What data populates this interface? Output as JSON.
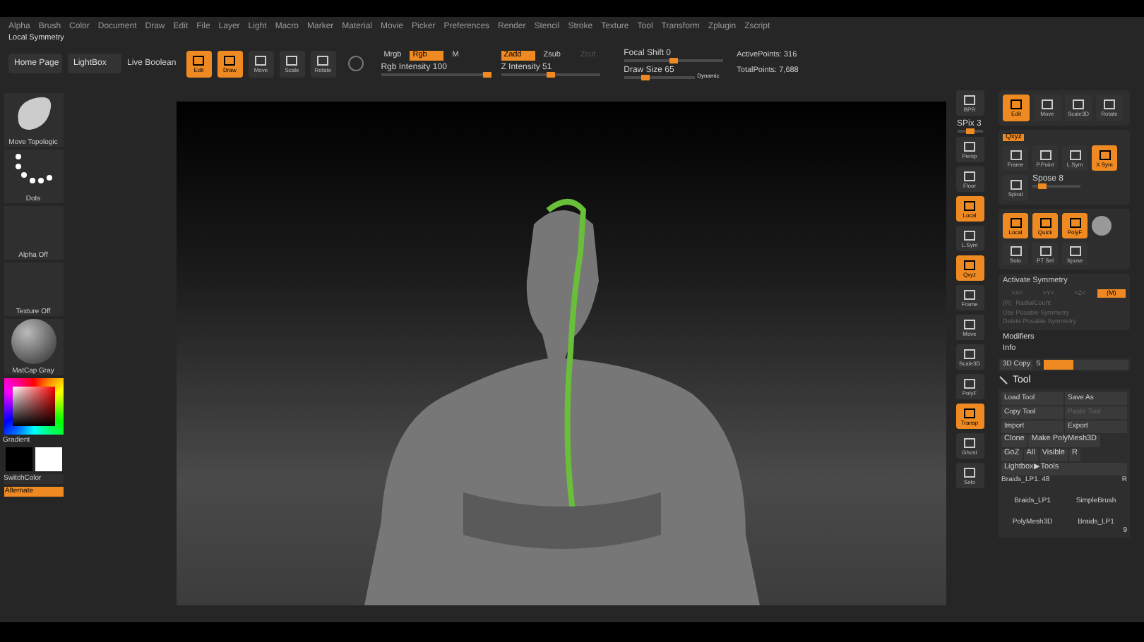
{
  "menu": [
    "Alpha",
    "Brush",
    "Color",
    "Document",
    "Draw",
    "Edit",
    "File",
    "Layer",
    "Light",
    "Macro",
    "Marker",
    "Material",
    "Movie",
    "Picker",
    "Preferences",
    "Render",
    "Stencil",
    "Stroke",
    "Texture",
    "Tool",
    "Transform",
    "Zplugin",
    "Zscript"
  ],
  "local_symmetry": "Local Symmetry",
  "toolbar": {
    "buttons": [
      "Home Page",
      "LightBox"
    ],
    "live_boolean": "Live Boolean",
    "modes": [
      {
        "label": "Edit",
        "selected": true
      },
      {
        "label": "Draw",
        "selected": true
      },
      {
        "label": "Move",
        "selected": false
      },
      {
        "label": "Scale",
        "selected": false
      },
      {
        "label": "Rotate",
        "selected": false
      }
    ],
    "color_modes": [
      {
        "label": "Mrgb",
        "selected": false
      },
      {
        "label": "Rgb",
        "selected": true
      },
      {
        "label": "M",
        "selected": false
      }
    ],
    "z_modes": [
      {
        "label": "Zadd",
        "selected": true,
        "disabled": false
      },
      {
        "label": "Zsub",
        "selected": false,
        "disabled": false
      },
      {
        "label": "Zcut",
        "selected": false,
        "disabled": true
      }
    ],
    "sliders": [
      {
        "label": "Rgb Intensity 100",
        "level": 1.0
      },
      {
        "label": "Z Intensity 51",
        "level": 0.51
      },
      {
        "label": "Focal Shift 0",
        "level": 0.5
      },
      {
        "label": "Draw Size 65",
        "level": 0.3
      }
    ],
    "dynamic": "Dynamic",
    "active_points": "ActivePoints: 316",
    "total_points": "TotalPoints: 7,688"
  },
  "left_panel": {
    "brush": "Move Topologic",
    "stroke": "Dots",
    "alpha": "Alpha Off",
    "texture": "Texture Off",
    "material": "MatCap Gray",
    "gradient": "Gradient",
    "switch_color": "SwitchColor",
    "alternate": {
      "label": "Alternate",
      "on": true
    }
  },
  "right_strip": [
    {
      "kind": "button",
      "label": "BPR",
      "on": false
    },
    {
      "kind": "slider",
      "label": "SPix 3",
      "level": 0.5
    },
    {
      "kind": "button",
      "label": "Persp",
      "on": false
    },
    {
      "kind": "button",
      "label": "Floor",
      "on": false
    },
    {
      "kind": "button",
      "label": "Local",
      "on": true
    },
    {
      "kind": "button",
      "label": "L.Sym",
      "on": false
    },
    {
      "kind": "button",
      "label": "Qxyz",
      "on": true
    },
    {
      "kind": "button",
      "label": "Frame",
      "on": false
    },
    {
      "kind": "button",
      "label": "Move",
      "on": false
    },
    {
      "kind": "button",
      "label": "Scale3D",
      "on": false
    },
    {
      "kind": "button",
      "label": "PolyF",
      "on": false
    },
    {
      "kind": "button",
      "label": "Transp",
      "on": true
    },
    {
      "kind": "button",
      "label": "Ghost",
      "on": false
    },
    {
      "kind": "button",
      "label": "Solo",
      "on": false
    }
  ],
  "right_panel": {
    "tools": [
      {
        "label": "Edit",
        "selected": true
      },
      {
        "label": "Move",
        "selected": false
      },
      {
        "label": "Scale3D",
        "selected": false
      },
      {
        "label": "Rotate",
        "selected": false
      }
    ],
    "transform": {
      "tab": "Qxyz",
      "buttons": [
        {
          "label": "Frame",
          "on": false
        },
        {
          "label": "P.Point",
          "on": false
        },
        {
          "label": "L.Sym",
          "on": false
        },
        {
          "label": "X Sym",
          "on": true
        },
        {
          "label": "Spiral",
          "on": false
        }
      ],
      "spose": {
        "label": "Spose 8",
        "level": 0.2
      },
      "row2": [
        {
          "label": "Local",
          "on": true
        },
        {
          "label": "Quick",
          "on": true
        },
        {
          "label": "PolyF",
          "on": true
        }
      ],
      "row3": [
        "Solo",
        "PT Sel",
        "Xpose"
      ]
    },
    "symmetry": {
      "title": "Activate Symmetry",
      "axes": [
        {
          "label": ">X<",
          "on": false
        },
        {
          "label": ">Y<",
          "on": false
        },
        {
          "label": ">Z<",
          "on": false
        },
        {
          "label": "(M)",
          "on": true
        }
      ],
      "r": "(R)",
      "radial": "RadialCount",
      "use": "Use Posable Symmetry",
      "delete": "Delete Posable Symmetry"
    },
    "modifiers": "Modifiers",
    "info": "Info",
    "copy": {
      "label": "3D Copy",
      "s": "S",
      "level": 0.35
    },
    "tool": {
      "title": "Tool",
      "buttons": [
        {
          "label": "Load Tool",
          "disabled": false
        },
        {
          "label": "Save As",
          "disabled": false
        },
        {
          "label": "Copy Tool",
          "disabled": false
        },
        {
          "label": "Paste Tool",
          "disabled": true
        },
        {
          "label": "Import",
          "disabled": false
        },
        {
          "label": "Export",
          "disabled": false
        }
      ],
      "clone": "Clone",
      "make": "Make PolyMesh3D",
      "goz": "GoZ",
      "all": "All",
      "visible": "Visible",
      "r": "R",
      "lightbox": "Lightbox▶Tools",
      "current": "Braids_LP1. 48",
      "current_r": "R",
      "thumbs": [
        "Braids_LP1",
        "SimpleBrush",
        "PolyMesh3D",
        "Braids_LP1"
      ],
      "thumb_count": "9"
    }
  }
}
